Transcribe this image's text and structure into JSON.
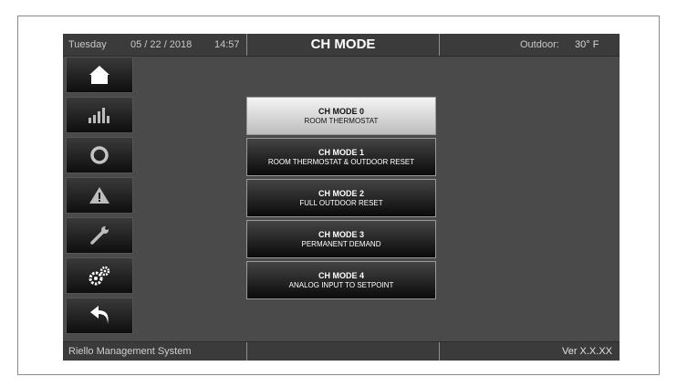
{
  "header": {
    "day": "Tuesday",
    "date": "05 / 22 / 2018",
    "time": "14:57",
    "title": "CH MODE",
    "outdoor_label": "Outdoor:",
    "outdoor_temp": "30° F"
  },
  "sidebar": {
    "items": [
      {
        "name": "home",
        "icon": "house-icon"
      },
      {
        "name": "statistics",
        "icon": "bar-chart-icon"
      },
      {
        "name": "status",
        "icon": "ring-icon"
      },
      {
        "name": "alarms",
        "icon": "warning-icon"
      },
      {
        "name": "service",
        "icon": "wrench-icon"
      },
      {
        "name": "settings",
        "icon": "gears-icon"
      },
      {
        "name": "back",
        "icon": "back-arrow-icon"
      }
    ]
  },
  "modes": [
    {
      "title": "CH MODE 0",
      "subtitle": "ROOM THERMOSTAT",
      "selected": true
    },
    {
      "title": "CH MODE 1",
      "subtitle": "ROOM THERMOSTAT & OUTDOOR RESET",
      "selected": false
    },
    {
      "title": "CH MODE 2",
      "subtitle": "FULL OUTDOOR RESET",
      "selected": false
    },
    {
      "title": "CH MODE 3",
      "subtitle": "PERMANENT DEMAND",
      "selected": false
    },
    {
      "title": "CH MODE 4",
      "subtitle": "ANALOG INPUT TO SETPOINT",
      "selected": false
    }
  ],
  "footer": {
    "system_name": "Riello Management System",
    "version": "Ver X.X.XX"
  }
}
